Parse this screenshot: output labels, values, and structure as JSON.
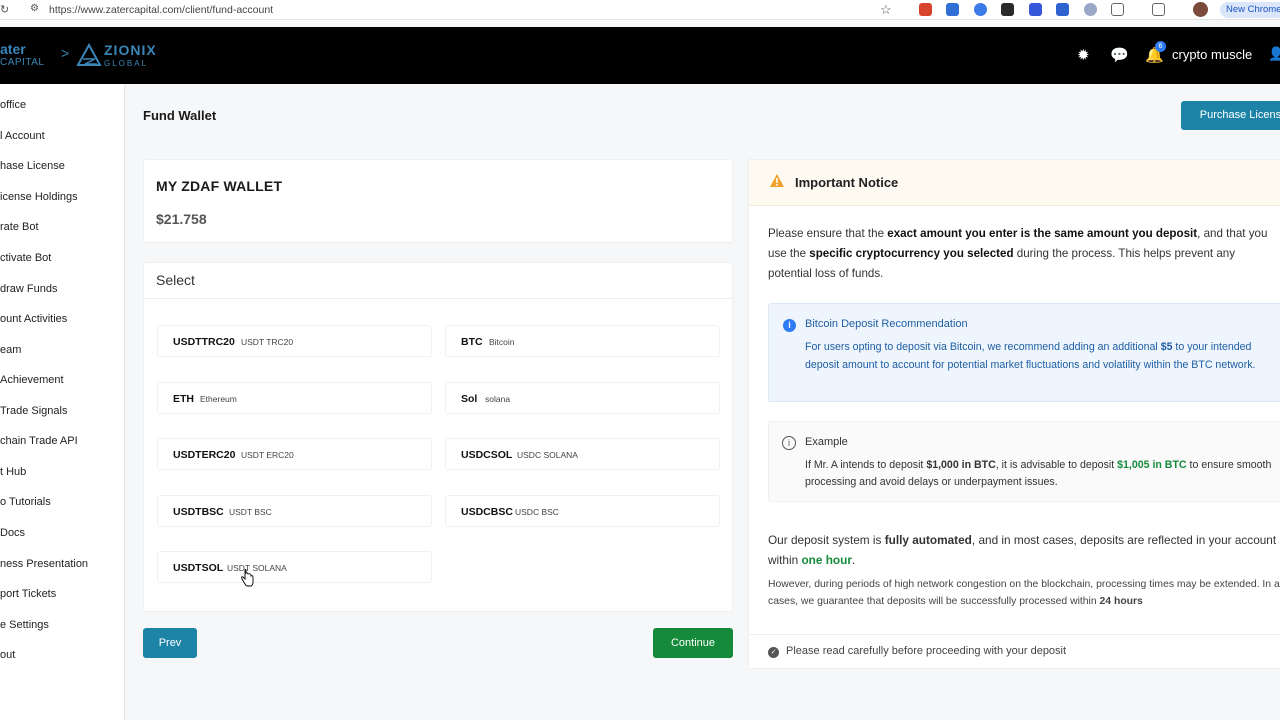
{
  "browser": {
    "url": "https://www.zatercapital.com/client/fund-account",
    "new_chrome_label": "New Chrome"
  },
  "header": {
    "brand_primary": "ater",
    "brand_primary_sub": "CAPITAL",
    "brand_separator": ">",
    "brand_secondary": "ZIONIX",
    "brand_secondary_sub": "GLOBAL",
    "notification_count": "6",
    "username": "crypto muscle"
  },
  "sidebar": {
    "items": [
      {
        "label": "office"
      },
      {
        "label": "l Account"
      },
      {
        "label": "hase License"
      },
      {
        "label": "icense Holdings"
      },
      {
        "label": "rate Bot"
      },
      {
        "label": "ctivate Bot"
      },
      {
        "label": "draw Funds"
      },
      {
        "label": "ount Activities"
      },
      {
        "label": "eam"
      },
      {
        "label": " Achievement"
      },
      {
        "label": "Trade Signals"
      },
      {
        "label": "chain Trade API"
      },
      {
        "label": "t Hub"
      },
      {
        "label": "o Tutorials"
      },
      {
        "label": "Docs"
      },
      {
        "label": "ness Presentation"
      },
      {
        "label": "port Tickets"
      },
      {
        "label": "e Settings"
      },
      {
        "label": "out"
      }
    ]
  },
  "main": {
    "page_title": "Fund Wallet",
    "purchase_button": "Purchase License",
    "wallet": {
      "name": "MY ZDAF WALLET",
      "balance": "$21.758"
    },
    "select": {
      "title": "Select",
      "coins": [
        {
          "code": "USDTTRC20",
          "desc": "USDT TRC20"
        },
        {
          "code": "BTC",
          "desc": "Bitcoin"
        },
        {
          "code": "ETH",
          "desc": "Ethereum"
        },
        {
          "code": "Sol",
          "desc": "solana"
        },
        {
          "code": "USDTERC20",
          "desc": "USDT ERC20"
        },
        {
          "code": "USDCSOL",
          "desc": "USDC SOLANA"
        },
        {
          "code": "USDTBSC",
          "desc": "USDT BSC"
        },
        {
          "code": "USDCBSC",
          "desc": "USDC BSC"
        },
        {
          "code": "USDTSOL",
          "desc": "USDT SOLANA"
        }
      ]
    },
    "prev_button": "Prev",
    "continue_button": "Continue"
  },
  "notice": {
    "title": "Important Notice",
    "p1_a": "Please ensure that the ",
    "p1_b": "exact amount you enter is the same amount you deposit",
    "p1_c": ", and that you use the ",
    "p1_d": "specific cryptocurrency you selected",
    "p1_e": " during the process. This helps prevent any potential loss of funds.",
    "recommendation": {
      "title": "Bitcoin Deposit Recommendation",
      "text_a": "For users opting to deposit via Bitcoin, we recommend adding an additional ",
      "text_b": "$5",
      "text_c": " to your intended deposit amount to account for potential market fluctuations and volatility within the BTC network."
    },
    "example": {
      "title": "Example",
      "text_a": "If Mr. A intends to deposit ",
      "text_b": "$1,000 in BTC",
      "text_c": ", it is advisable to deposit ",
      "text_d": "$1,005 in BTC",
      "text_e": " to ensure smooth processing and avoid delays or underpayment issues."
    },
    "p2_a": "Our deposit system is ",
    "p2_b": "fully automated",
    "p2_c": ", and in most cases, deposits are reflected in your account within ",
    "p2_d": "one hour",
    "p2_e": ".",
    "p3_a": "However, during periods of high network congestion on the blockchain, processing times may be extended. In all cases, we guarantee that deposits will be successfully processed within ",
    "p3_b": "24 hours",
    "footer": "Please read carefully before proceeding with your deposit"
  }
}
